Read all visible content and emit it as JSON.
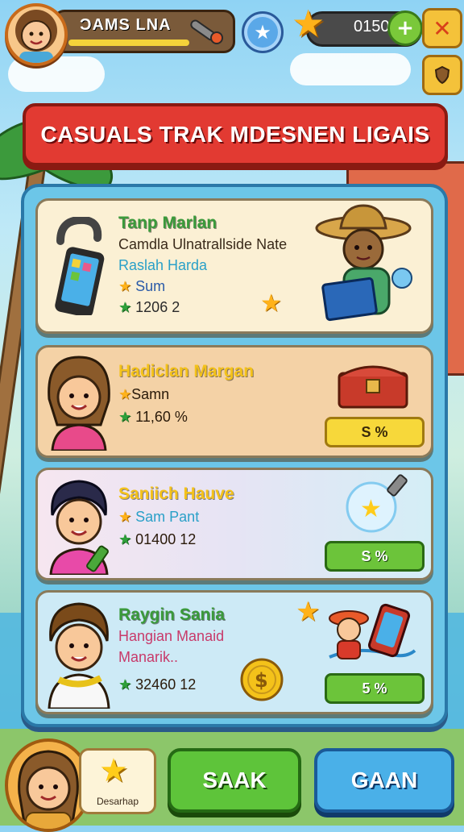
{
  "hud": {
    "player_name": "ƆAMS LNA",
    "coins": "0150",
    "plus_symbol": "+",
    "close_symbol": "✕",
    "avatar_icon": "girl-avatar-icon",
    "progress_icon": "wrench-icon",
    "badge_icon": "star-badge-icon"
  },
  "title": "CASUALS TRAK MDESNEN LIGAIS",
  "cards": [
    {
      "name": "Tanp Marlan",
      "line2": "Camdla Ulnatrallside Nate",
      "line3": "Raslah Harda",
      "star_label": "Sum",
      "score": "1206 2"
    },
    {
      "name": "Hadiclan Margan",
      "star_label": "Samn",
      "score": "11,60 %",
      "action": "S %"
    },
    {
      "name": "Saniich Hauve",
      "star_label": "Sam Pant",
      "score": "01400 12",
      "action": "S %"
    },
    {
      "name": "Raygin Sania",
      "line2": "Hangian Manaid",
      "line3": "Manarik..",
      "score": "32460 12",
      "action": "5 %"
    }
  ],
  "bottom": {
    "desc_label": "Desarhap",
    "btn_left": "SAAK",
    "btn_right": "GAAN"
  },
  "symbols": {
    "star": "★"
  },
  "colors": {
    "title_red": "#e23a32",
    "panel_blue": "#6cc6e8",
    "name_yellow": "#f4d23a",
    "name_green": "#3a9a3a",
    "name_cyan": "#2aa0c8",
    "name_pink": "#c83a6a",
    "green_button": "#5ec43a",
    "blue_button": "#4ab0e8"
  }
}
